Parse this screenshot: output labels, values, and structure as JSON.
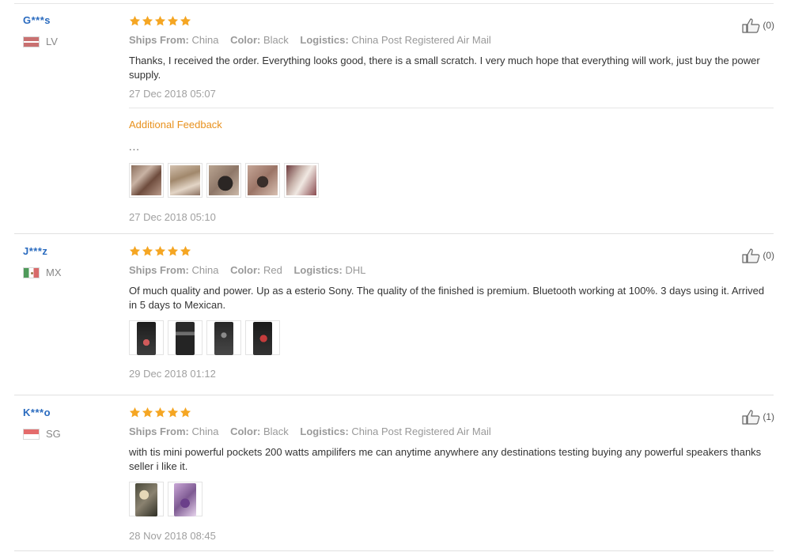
{
  "labels": {
    "ships_from": "Ships From:",
    "color": "Color:",
    "logistics": "Logistics:",
    "additional_feedback": "Additional Feedback"
  },
  "colors": {
    "star": "#f5a623",
    "user_name": "#2a6bbf",
    "additional_feedback": "#e8911d"
  },
  "reviews": [
    {
      "user": "G***s",
      "country": "LV",
      "flag_icon": "latvia-flag-icon",
      "rating": 5,
      "ships_from": "China",
      "color": "Black",
      "logistics": "China Post Registered Air Mail",
      "text": "Thanks, I received the order. Everything looks good, there is a small scratch. I very much hope that everything will work, just buy the power supply.",
      "date": "27 Dec 2018 05:07",
      "likes": "(0)",
      "additional": {
        "text": "...",
        "photo_count": 5,
        "date": "27 Dec 2018 05:10"
      }
    },
    {
      "user": "J***z",
      "country": "MX",
      "flag_icon": "mexico-flag-icon",
      "rating": 5,
      "ships_from": "China",
      "color": "Red",
      "logistics": "DHL",
      "text": "Of much quality and power. Up as a esterio Sony. The quality of the finished is premium. Bluetooth working at 100%. 3 days using it. Arrived in 5 days to Mexican.",
      "photo_count": 4,
      "date": "29 Dec 2018 01:12",
      "likes": "(0)"
    },
    {
      "user": "K***o",
      "country": "SG",
      "flag_icon": "singapore-flag-icon",
      "rating": 5,
      "ships_from": "China",
      "color": "Black",
      "logistics": "China Post Registered Air Mail",
      "text": "with tis mini powerful pockets 200 watts ampilifers me can anytime anywhere any destinations testing buying any powerful speakers thanks seller i like it.",
      "photo_count": 2,
      "date": "28 Nov 2018 08:45",
      "likes": "(1)"
    }
  ]
}
